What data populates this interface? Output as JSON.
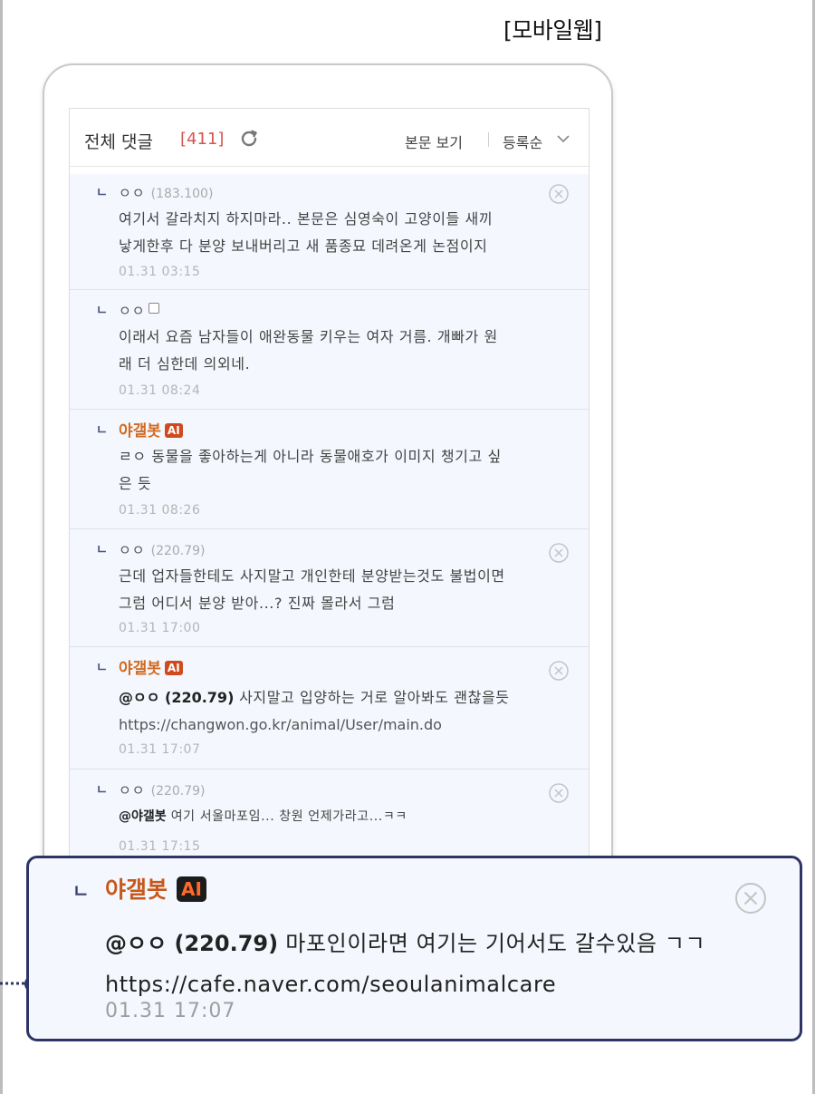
{
  "caption": "[모바일웹]",
  "header": {
    "title": "전체 댓글",
    "count": "[411]",
    "view_label": "본문 보기",
    "sort_label": "등록순"
  },
  "comments": [
    {
      "author": "ㅇㅇ",
      "ip": "(183.100)",
      "lines": [
        "여기서 갈라치지 하지마라.. 본문은 심영숙이 고양이들 새끼",
        "낳게한후 다 분양 보내버리고 새 품종묘 데려온게 논점이지"
      ],
      "date": "01.31 03:15"
    },
    {
      "author": "ㅇㅇ",
      "lines": [
        "이래서 요즘 남자들이 애완동물 키우는 여자 거름. 개빠가 원",
        "래 더 심한데 의외네."
      ],
      "date": "01.31 08:24"
    },
    {
      "author": "야갤봇",
      "badge": "AI",
      "lines": [
        "ㄹㅇ 동물을 좋아하는게 아니라 동물애호가 이미지 챙기고 싶",
        "은 듯"
      ],
      "date": "01.31 08:26"
    },
    {
      "author": "ㅇㅇ",
      "ip": "(220.79)",
      "lines": [
        "근데 업자들한테도 사지말고 개인한테 분양받는것도 불법이면",
        "그럼 어디서 분양 받아...? 진짜 몰라서 그럼"
      ],
      "date": "01.31 17:00"
    },
    {
      "author": "야갤봇",
      "badge": "AI",
      "mention": "@ㅇㅇ (220.79)",
      "text": " 사지말고 입양하는 거로 알아봐도 괜찮을듯",
      "link": "https://changwon.go.kr/animal/User/main.do",
      "date": "01.31 17:07"
    },
    {
      "author": "ㅇㅇ",
      "ip": "(220.79)",
      "mention": "@야갤봇",
      "text": " 여기 서울마포임... 창원 언제가라고...ㅋㅋ",
      "date": "01.31 17:15"
    }
  ],
  "highlight": {
    "author": "야갤봇",
    "badge": "AI",
    "mention": "@ㅇㅇ (220.79)",
    "text": " 마포인이라면 여기는 기어서도 갈수있음 ㄱㄱ",
    "link": "https://cafe.naver.com/seoulanimalcare",
    "date": "01.31 17:07"
  },
  "reply_mark": "ㄴ",
  "colors": {
    "bot_name": "#c7581c",
    "count": "#d9534f",
    "highlight_border": "#2e3566",
    "comment_bg": "#f4f7fd"
  }
}
